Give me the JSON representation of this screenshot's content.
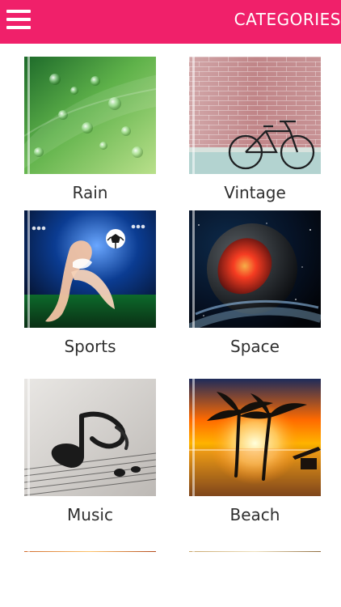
{
  "header": {
    "title": "CATEGORIES",
    "menu_icon": "hamburger-menu-icon",
    "accent_color": "#f0206a"
  },
  "categories": [
    {
      "label": "Rain"
    },
    {
      "label": "Vintage"
    },
    {
      "label": "Sports"
    },
    {
      "label": "Space"
    },
    {
      "label": "Music"
    },
    {
      "label": "Beach"
    }
  ]
}
